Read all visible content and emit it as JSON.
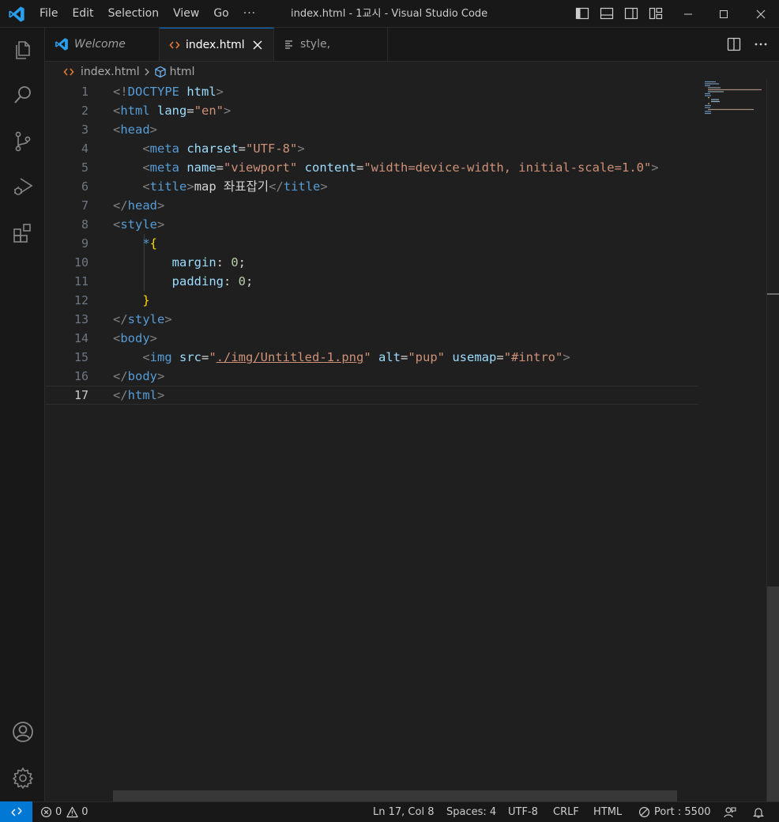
{
  "window": {
    "title": "index.html - 1교시 - Visual Studio Code",
    "menu": [
      "File",
      "Edit",
      "Selection",
      "View",
      "Go"
    ],
    "more": "···"
  },
  "tabs": [
    {
      "label": "Welcome",
      "icon": "vscode-logo-icon",
      "active": false
    },
    {
      "label": "index.html",
      "icon": "html-file-icon",
      "active": true
    },
    {
      "label": "style,",
      "icon": "text-file-icon",
      "active": false
    }
  ],
  "breadcrumb": {
    "file": "index.html",
    "symbol": "html"
  },
  "editor": {
    "current_line": 17,
    "line_numbers": [
      "1",
      "2",
      "3",
      "4",
      "5",
      "6",
      "7",
      "8",
      "9",
      "10",
      "11",
      "12",
      "13",
      "14",
      "15",
      "16",
      "17"
    ]
  },
  "code": {
    "l1": {
      "open": "<!",
      "kw": "DOCTYPE",
      "sp": " ",
      "name": "html",
      "close": ">"
    },
    "l2": {
      "lt": "<",
      "tag": "html",
      "attr": " lang",
      "eq": "=",
      "val": "\"en\"",
      "gt": ">"
    },
    "l3": {
      "lt": "<",
      "tag": "head",
      "gt": ">"
    },
    "l4": {
      "indent": "    ",
      "lt": "<",
      "tag": "meta",
      "attr": " charset",
      "eq": "=",
      "val": "\"UTF-8\"",
      "gt": ">"
    },
    "l5": {
      "indent": "    ",
      "lt": "<",
      "tag": "meta",
      "attr1": " name",
      "eq1": "=",
      "val1": "\"viewport\"",
      "attr2": " content",
      "eq2": "=",
      "val2": "\"width=device-width, initial-scale=1.0\"",
      "gt": ">"
    },
    "l6": {
      "indent": "    ",
      "lt": "<",
      "tag": "title",
      "gt": ">",
      "text": "map 좌표잡기",
      "lt2": "</",
      "tag2": "title",
      "gt2": ">"
    },
    "l7": {
      "lt": "</",
      "tag": "head",
      "gt": ">"
    },
    "l8": {
      "lt": "<",
      "tag": "style",
      "gt": ">"
    },
    "l9": {
      "indent": "    ",
      "sel": "*",
      "brace": "{"
    },
    "l10": {
      "indent": "        ",
      "prop": "margin",
      "colon": ": ",
      "num": "0",
      "semi": ";"
    },
    "l11": {
      "indent": "        ",
      "prop": "padding",
      "colon": ": ",
      "num": "0",
      "semi": ";"
    },
    "l12": {
      "indent": "    ",
      "brace": "}"
    },
    "l13": {
      "lt": "</",
      "tag": "style",
      "gt": ">"
    },
    "l14": {
      "lt": "<",
      "tag": "body",
      "gt": ">"
    },
    "l15": {
      "indent": "    ",
      "lt": "<",
      "tag": "img",
      "attr1": " src",
      "eq1": "=",
      "q1": "\"",
      "link": "./img/Untitled-1.png",
      "q2": "\"",
      "attr2": " alt",
      "eq2": "=",
      "val2": "\"pup\"",
      "attr3": " usemap",
      "eq3": "=",
      "val3": "\"#intro\"",
      "gt": ">"
    },
    "l16": {
      "lt": "</",
      "tag": "body",
      "gt": ">"
    },
    "l17": {
      "lt": "</",
      "tag": "html",
      "gt": ">"
    }
  },
  "status": {
    "errors": "0",
    "warnings": "0",
    "position": "Ln 17, Col 8",
    "spaces": "Spaces: 4",
    "encoding": "UTF-8",
    "eol": "CRLF",
    "language": "HTML",
    "port": "Port : 5500"
  },
  "colors": {
    "accent": "#0078d4",
    "tag": "#569cd6",
    "attribute": "#9cdcfe",
    "string": "#ce9178",
    "number": "#b5cea8",
    "bracket": "#ffd700"
  }
}
